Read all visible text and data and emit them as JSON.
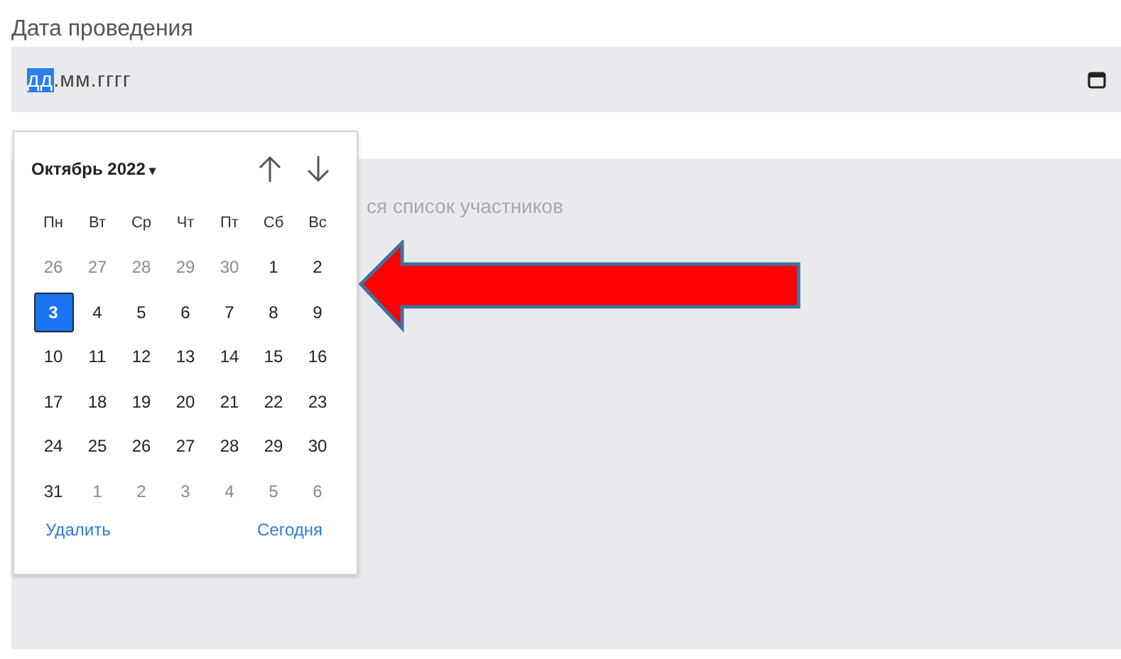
{
  "label": "Дата проведения",
  "date_field": {
    "segments": [
      {
        "text": "дд",
        "selected": true
      },
      {
        "text": ".мм.гггг",
        "selected": false
      }
    ]
  },
  "participants_field": {
    "placeholder": "ся список участников"
  },
  "calendar": {
    "month": "Октябрь 2022",
    "caret": "▾",
    "weekdays": [
      "Пн",
      "Вт",
      "Ср",
      "Чт",
      "Пт",
      "Сб",
      "Вс"
    ],
    "days": [
      {
        "text": "26",
        "muted": true,
        "selected": false
      },
      {
        "text": "27",
        "muted": true,
        "selected": false
      },
      {
        "text": "28",
        "muted": true,
        "selected": false
      },
      {
        "text": "29",
        "muted": true,
        "selected": false
      },
      {
        "text": "30",
        "muted": true,
        "selected": false
      },
      {
        "text": "1",
        "muted": false,
        "selected": false
      },
      {
        "text": "2",
        "muted": false,
        "selected": false
      },
      {
        "text": "3",
        "muted": false,
        "selected": true
      },
      {
        "text": "4",
        "muted": false,
        "selected": false
      },
      {
        "text": "5",
        "muted": false,
        "selected": false
      },
      {
        "text": "6",
        "muted": false,
        "selected": false
      },
      {
        "text": "7",
        "muted": false,
        "selected": false
      },
      {
        "text": "8",
        "muted": false,
        "selected": false
      },
      {
        "text": "9",
        "muted": false,
        "selected": false
      },
      {
        "text": "10",
        "muted": false,
        "selected": false
      },
      {
        "text": "11",
        "muted": false,
        "selected": false
      },
      {
        "text": "12",
        "muted": false,
        "selected": false
      },
      {
        "text": "13",
        "muted": false,
        "selected": false
      },
      {
        "text": "14",
        "muted": false,
        "selected": false
      },
      {
        "text": "15",
        "muted": false,
        "selected": false
      },
      {
        "text": "16",
        "muted": false,
        "selected": false
      },
      {
        "text": "17",
        "muted": false,
        "selected": false
      },
      {
        "text": "18",
        "muted": false,
        "selected": false
      },
      {
        "text": "19",
        "muted": false,
        "selected": false
      },
      {
        "text": "20",
        "muted": false,
        "selected": false
      },
      {
        "text": "21",
        "muted": false,
        "selected": false
      },
      {
        "text": "22",
        "muted": false,
        "selected": false
      },
      {
        "text": "23",
        "muted": false,
        "selected": false
      },
      {
        "text": "24",
        "muted": false,
        "selected": false
      },
      {
        "text": "25",
        "muted": false,
        "selected": false
      },
      {
        "text": "26",
        "muted": false,
        "selected": false
      },
      {
        "text": "27",
        "muted": false,
        "selected": false
      },
      {
        "text": "28",
        "muted": false,
        "selected": false
      },
      {
        "text": "29",
        "muted": false,
        "selected": false
      },
      {
        "text": "30",
        "muted": false,
        "selected": false
      },
      {
        "text": "31",
        "muted": false,
        "selected": false
      },
      {
        "text": "1",
        "muted": true,
        "selected": false
      },
      {
        "text": "2",
        "muted": true,
        "selected": false
      },
      {
        "text": "3",
        "muted": true,
        "selected": false
      },
      {
        "text": "4",
        "muted": true,
        "selected": false
      },
      {
        "text": "5",
        "muted": true,
        "selected": false
      },
      {
        "text": "6",
        "muted": true,
        "selected": false
      }
    ],
    "buttons": [
      "Удалить",
      "Сегодня"
    ]
  }
}
